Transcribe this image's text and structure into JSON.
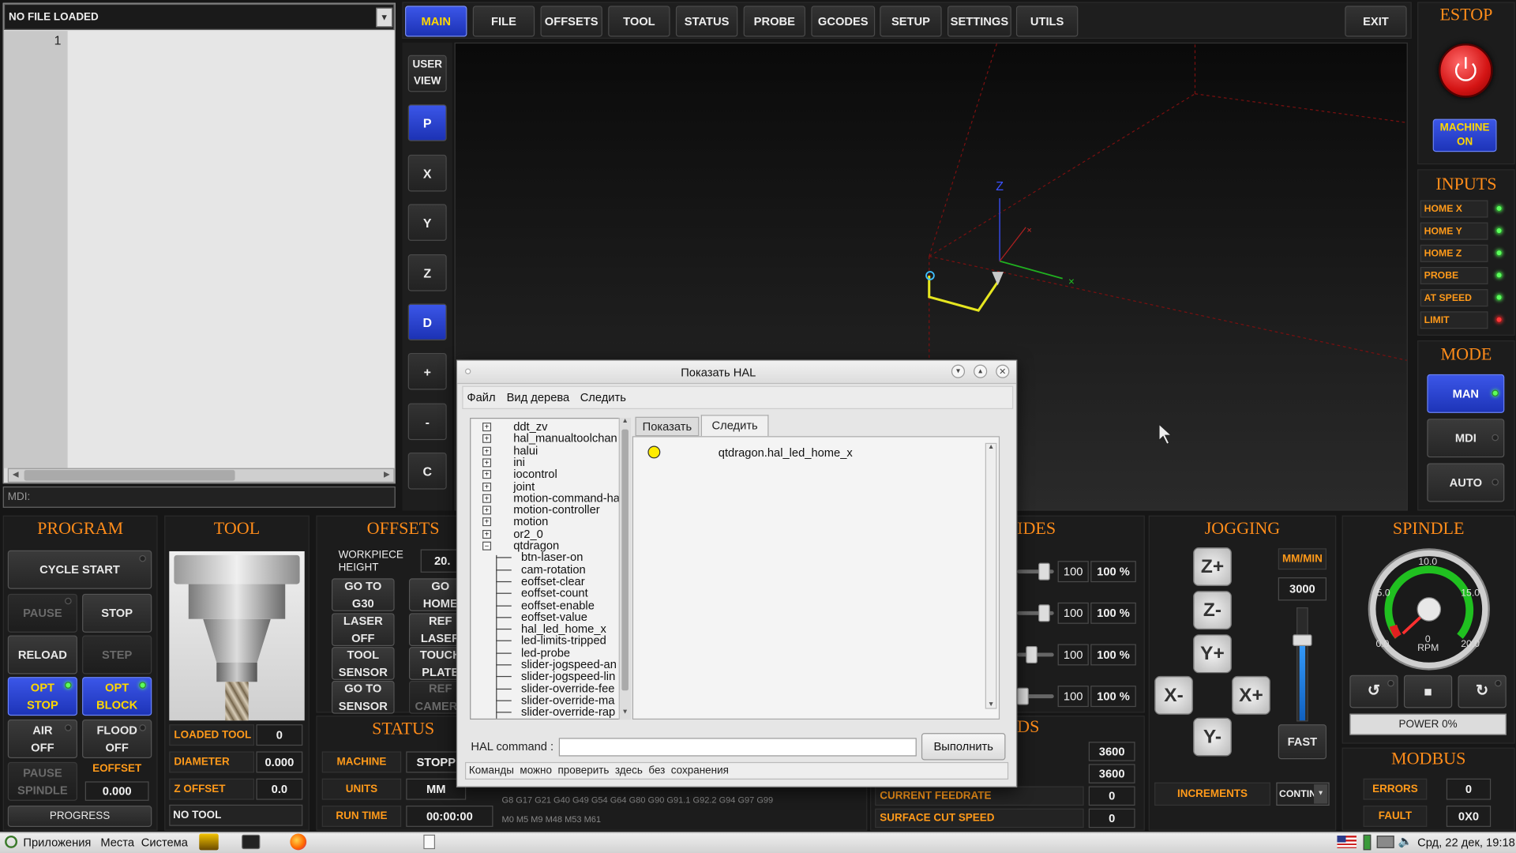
{
  "file": {
    "title": "NO FILE LOADED",
    "line_number": "1",
    "mdi_label": "MDI:"
  },
  "tabs": [
    "MAIN",
    "FILE",
    "OFFSETS",
    "TOOL",
    "STATUS",
    "PROBE",
    "GCODES",
    "SETUP",
    "SETTINGS",
    "UTILS"
  ],
  "exit_label": "EXIT",
  "side_view": {
    "user_view": "USER\nVIEW",
    "buttons": [
      "P",
      "X",
      "Y",
      "Z",
      "D",
      "+",
      "-",
      "C"
    ]
  },
  "axes": {
    "x": "X",
    "y": "Y",
    "z": "Z"
  },
  "estop": {
    "title": "ESTOP",
    "machine_on": "MACHINE\nON"
  },
  "inputs": {
    "title": "INPUTS",
    "items": [
      {
        "label": "HOME X",
        "state": "on"
      },
      {
        "label": "HOME Y",
        "state": "on"
      },
      {
        "label": "HOME Z",
        "state": "on"
      },
      {
        "label": "PROBE",
        "state": "on"
      },
      {
        "label": "AT SPEED",
        "state": "on"
      },
      {
        "label": "LIMIT",
        "state": "red"
      }
    ]
  },
  "mode": {
    "title": "MODE",
    "items": [
      "MAN",
      "MDI",
      "AUTO"
    ]
  },
  "program": {
    "title": "PROGRAM",
    "cycle_start": "CYCLE START",
    "pause": "PAUSE",
    "stop": "STOP",
    "reload": "RELOAD",
    "step": "STEP",
    "opt_stop": "OPT\nSTOP",
    "opt_block": "OPT\nBLOCK",
    "air_off": "AIR\nOFF",
    "flood_off": "FLOOD\nOFF",
    "pause_spindle": "PAUSE\nSPINDLE",
    "eoffset": "EOFFSET",
    "eoffset_value": "0.000",
    "progress": "PROGRESS"
  },
  "tool": {
    "title": "TOOL",
    "loaded_tool_label": "LOADED TOOL",
    "loaded_tool": "0",
    "diameter_label": "DIAMETER",
    "diameter": "0.000",
    "z_offset_label": "Z OFFSET",
    "z_offset": "0.0",
    "no_tool": "NO TOOL"
  },
  "offsets": {
    "title": "OFFSETS",
    "workpiece_height": "WORKPIECE\nHEIGHT",
    "workpiece_value": "20.",
    "buttons": [
      "GO TO\nG30",
      "GO\nHOME",
      "LASER\nOFF",
      "REF\nLASER",
      "TOOL\nSENSOR",
      "TOUCH\nPLATE",
      "GO TO\nSENSOR",
      "REF\nCAMERA"
    ]
  },
  "status": {
    "title": "STATUS",
    "machine_label": "MACHINE",
    "machine_value": "STOPP",
    "units_label": "UNITS",
    "units_value": "MM",
    "runtime_label": "RUN TIME",
    "runtime_value": "00:00:00",
    "gcodes_line1": "G8 G17 G21 G40 G49 G54 G64 G80 G90 G91.1 G92.2 G94 G97 G99",
    "gcodes_line2": "M0 M5 M9 M48 M53 M61"
  },
  "overrides": {
    "title_fragment": "IDES",
    "rows": [
      {
        "value": "100",
        "pct": "100 %",
        "fill": 0.72
      },
      {
        "value": "100",
        "pct": "100 %",
        "fill": 0.72
      },
      {
        "value": "100",
        "pct": "100 %",
        "fill": 0.3
      },
      {
        "value": "100",
        "pct": "100 %",
        "fill": 0
      }
    ]
  },
  "rates": {
    "title_fragment": "DS",
    "row1": "3600",
    "row2": "3600",
    "current_feedrate_label": "CURRENT FEEDRATE",
    "current_feedrate": "0",
    "surface_cut_speed_label": "SURFACE CUT SPEED",
    "surface_cut_speed": "0"
  },
  "jogging": {
    "title": "JOGGING",
    "unit": "MM/MIN",
    "rate": "3000",
    "fast": "FAST",
    "increments": "INCREMENTS",
    "increments_value": "CONTINU",
    "buttons": [
      "Z+",
      "Z-",
      "Y+",
      "X-",
      "X+",
      "Y-"
    ],
    "slider_level": 0.75
  },
  "spindle": {
    "title": "SPINDLE",
    "gauge_ticks": [
      "0.0",
      "5.0",
      "10.0",
      "15.0",
      "20.0"
    ],
    "rpm_value": "0",
    "rpm_label": "RPM",
    "power": "POWER 0%",
    "stop_symbol": "■"
  },
  "modbus": {
    "title": "MODBUS",
    "errors_label": "ERRORS",
    "errors": "0",
    "fault_label": "FAULT",
    "fault": "0X0"
  },
  "hal": {
    "title": "Показать HAL",
    "menu": [
      "Файл",
      "Вид дерева",
      "Следить"
    ],
    "tabs": [
      "Показать",
      "Следить"
    ],
    "tree": [
      "ddt_zv",
      "hal_manualtoolchan",
      "halui",
      "ini",
      "iocontrol",
      "joint",
      "motion-command-ha",
      "motion-controller",
      "motion",
      "or2_0",
      "qtdragon",
      "btn-laser-on",
      "cam-rotation",
      "eoffset-clear",
      "eoffset-count",
      "eoffset-enable",
      "eoffset-value",
      "hal_led_home_x",
      "led-limits-tripped",
      "led-probe",
      "slider-jogspeed-an",
      "slider-jogspeed-lin",
      "slider-override-fee",
      "slider-override-ma",
      "slider-override-rap"
    ],
    "watch_item": "qtdragon.hal_led_home_x",
    "command_label": "HAL command :",
    "execute": "Выполнить",
    "status_text": "Команды  можно  проверить  здесь  без  сохранения"
  },
  "taskbar": {
    "apps": "Приложения",
    "places": "Места",
    "system": "Система",
    "clock": "Срд, 22 дек, 19:18"
  }
}
